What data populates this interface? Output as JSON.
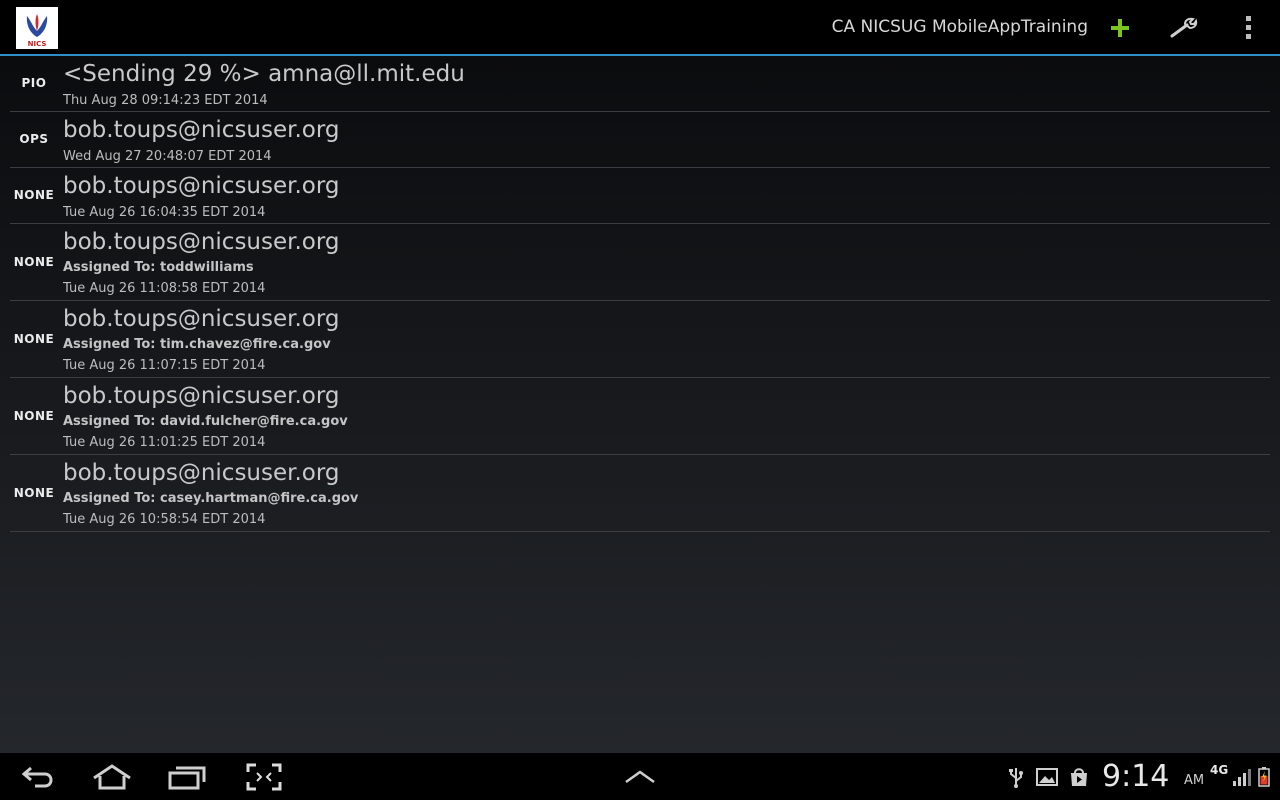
{
  "action_bar": {
    "title": "CA NICSUG MobileAppTraining",
    "logo_text": "NICS",
    "add_icon": "plus-icon",
    "settings_icon": "wrench-icon",
    "overflow_icon": "overflow-menu-icon",
    "accent_color": "#2f8fc6",
    "add_color": "#7cc41f"
  },
  "messages": [
    {
      "badge": "PIO",
      "sender": "<Sending 29 %> amna@ll.mit.edu",
      "assigned": "",
      "time": "Thu Aug 28 09:14:23 EDT 2014"
    },
    {
      "badge": "OPS",
      "sender": "bob.toups@nicsuser.org",
      "assigned": "",
      "time": "Wed Aug 27 20:48:07 EDT 2014"
    },
    {
      "badge": "NONE",
      "sender": "bob.toups@nicsuser.org",
      "assigned": "",
      "time": "Tue Aug 26 16:04:35 EDT 2014"
    },
    {
      "badge": "NONE",
      "sender": "bob.toups@nicsuser.org",
      "assigned": "Assigned To: toddwilliams",
      "time": "Tue Aug 26 11:08:58 EDT 2014"
    },
    {
      "badge": "NONE",
      "sender": "bob.toups@nicsuser.org",
      "assigned": "Assigned To: tim.chavez@fire.ca.gov",
      "time": "Tue Aug 26 11:07:15 EDT 2014"
    },
    {
      "badge": "NONE",
      "sender": "bob.toups@nicsuser.org",
      "assigned": "Assigned To: david.fulcher@fire.ca.gov",
      "time": "Tue Aug 26 11:01:25 EDT 2014"
    },
    {
      "badge": "NONE",
      "sender": "bob.toups@nicsuser.org",
      "assigned": "Assigned To: casey.hartman@fire.ca.gov",
      "time": "Tue Aug 26 10:58:54 EDT 2014"
    }
  ],
  "system_bar": {
    "buttons": [
      "back-icon",
      "home-icon",
      "recent-apps-icon",
      "screenshot-icon",
      "expand-up-icon"
    ],
    "status_icons": [
      "usb-icon",
      "gallery-icon",
      "play-store-icon",
      "signal-icon",
      "battery-icon"
    ],
    "clock": "9:14",
    "ampm": "AM",
    "network": "4G"
  }
}
